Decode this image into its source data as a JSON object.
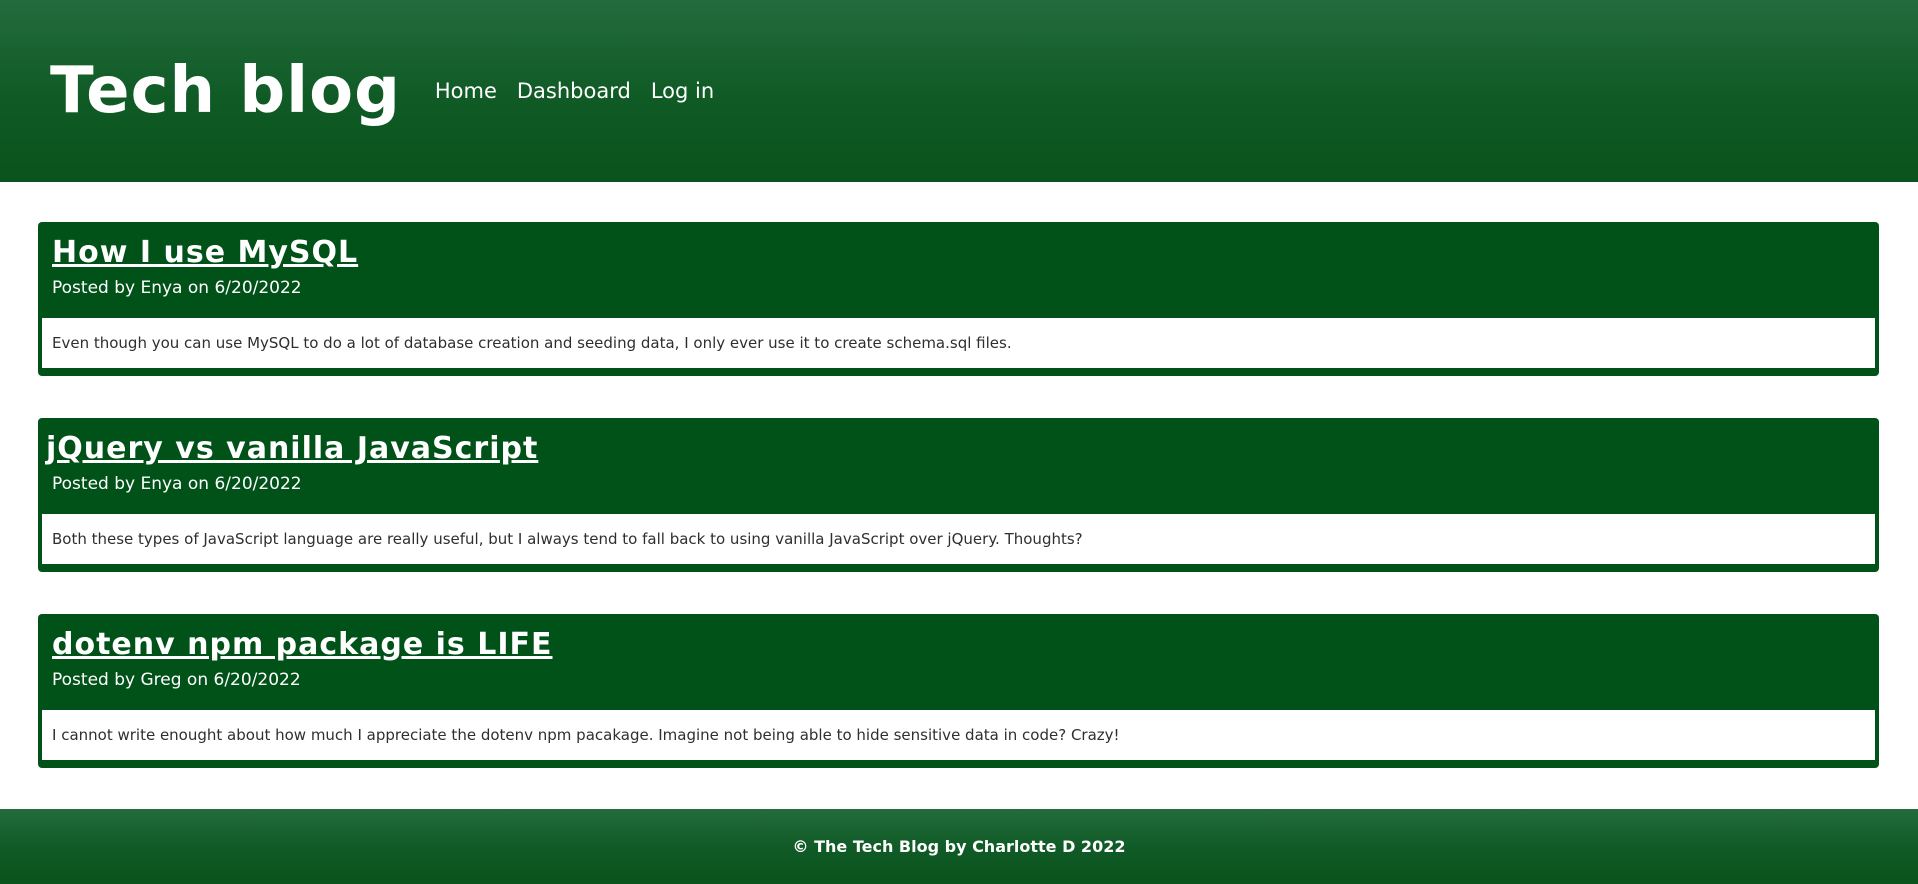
{
  "header": {
    "title": "Tech blog",
    "nav": [
      {
        "label": "Home"
      },
      {
        "label": "Dashboard"
      },
      {
        "label": "Log in"
      }
    ]
  },
  "posts": [
    {
      "title": "How I use MySQL",
      "meta": "Posted by Enya on 6/20/2022",
      "body": "Even though you can use MySQL to do a lot of database creation and seeding data, I only ever use it to create schema.sql files."
    },
    {
      "title": "jQuery vs vanilla JavaScript",
      "meta": "Posted by Enya on 6/20/2022",
      "body": "Both these types of JavaScript language are really useful, but I always tend to fall back to using vanilla JavaScript over jQuery. Thoughts?"
    },
    {
      "title": "dotenv npm package is LIFE",
      "meta": "Posted by Greg on 6/20/2022",
      "body": "I cannot write enought about how much I appreciate the dotenv npm pacakage. Imagine not being able to hide sensitive data in code? Crazy!"
    }
  ],
  "footer": {
    "text": "© The Tech Blog by Charlotte D 2022"
  },
  "colors": {
    "header_green": "#236b3c",
    "card_green": "#005219",
    "text_white": "#ffffff"
  }
}
